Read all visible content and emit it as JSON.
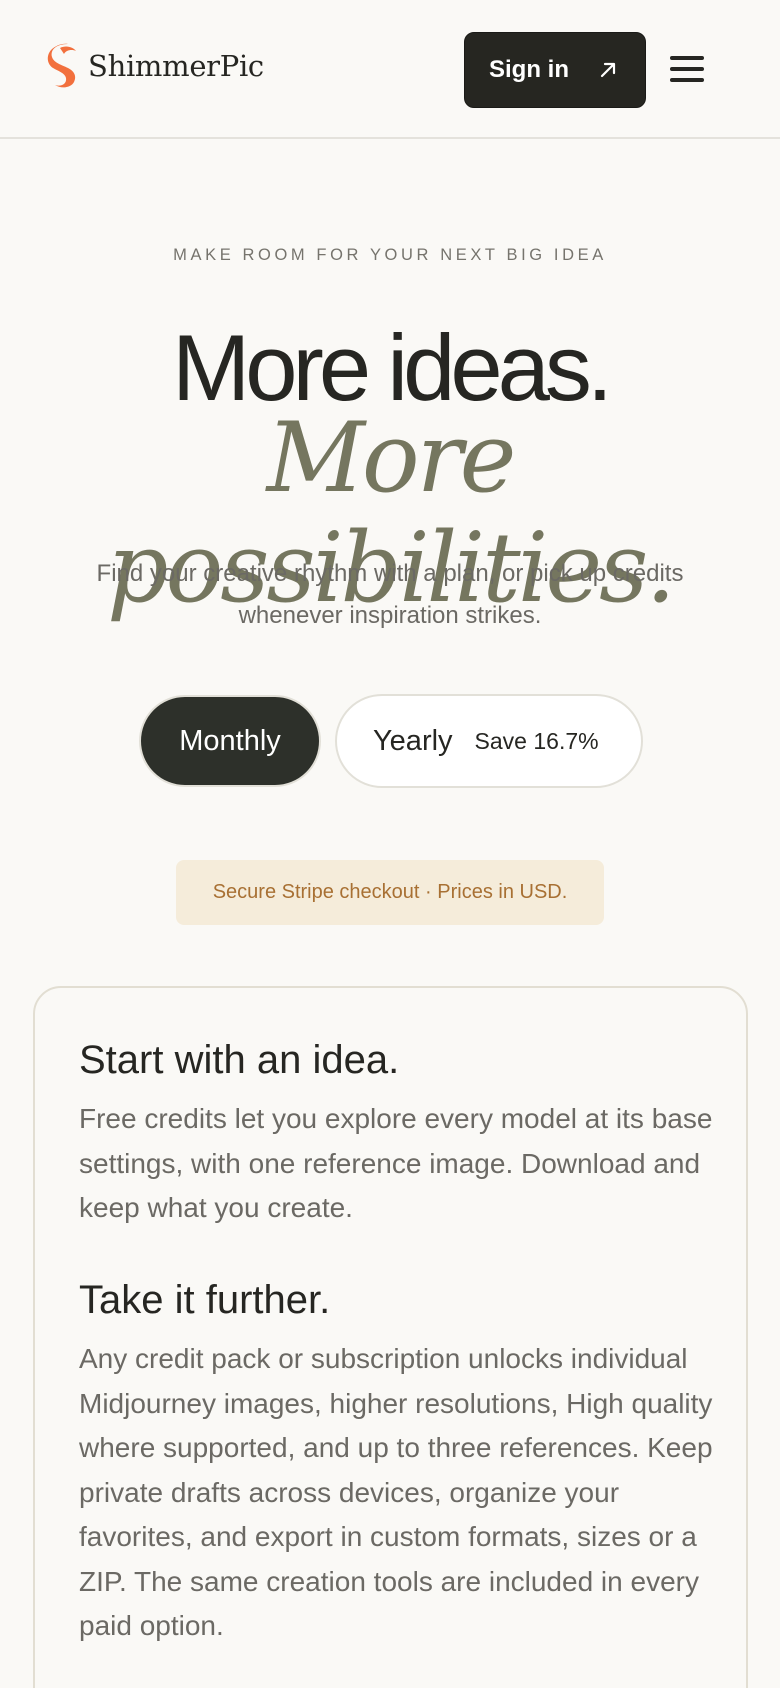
{
  "header": {
    "brand_name": "ShimmerPic",
    "signin_label": "Sign in",
    "icons": {
      "logo": "brand-s-logo-icon",
      "signin": "arrow-up-right-icon",
      "menu": "hamburger-menu-icon"
    },
    "colors": {
      "logo": "#F2703D",
      "signin_bg": "#262621"
    }
  },
  "hero": {
    "eyebrow": "MAKE ROOM FOR YOUR NEXT BIG IDEA",
    "headline": "More ideas.",
    "headline_italic": "More possibilities.",
    "subtitle": "Find your creative rhythm with a plan, or pick up credits whenever inspiration strikes."
  },
  "billing_toggle": {
    "monthly_label": "Monthly",
    "yearly_label": "Yearly",
    "yearly_save": "Save 16.7%",
    "selected": "Monthly"
  },
  "notice": {
    "text": "Secure Stripe checkout · Prices in USD."
  },
  "card": {
    "heading_1": "Start with an idea.",
    "paragraph_1": "Free credits let you explore every model at its base settings, with one reference image. Download and keep what you create.",
    "heading_2": "Take it further.",
    "paragraph_2": "Any credit pack or subscription unlocks individual Midjourney images, higher resolutions, High quality where supported, and up to three references. Keep private drafts across devices, organize your favorites, and export in custom formats, sizes or a ZIP. The same creation tools are included in every paid option."
  }
}
